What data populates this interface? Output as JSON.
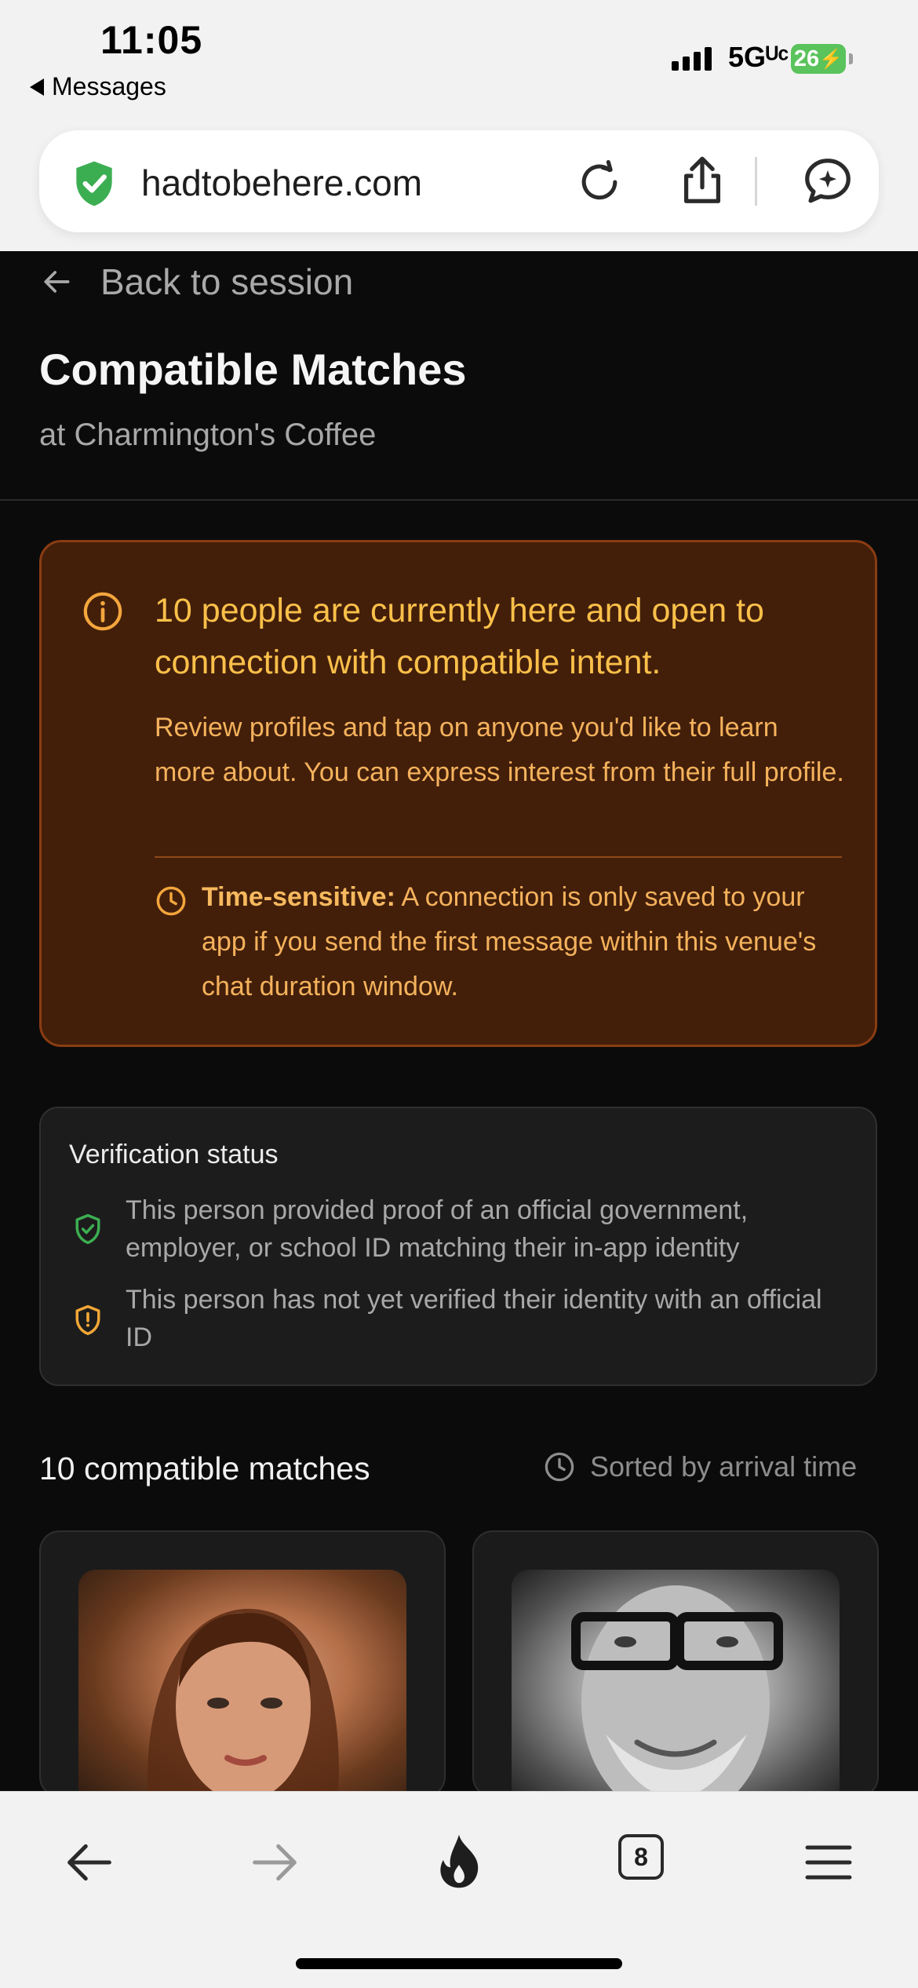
{
  "status_bar": {
    "time": "11:05",
    "back_app_label": "Messages",
    "network": "5Gᵁᶜ",
    "battery": "26"
  },
  "url_bar": {
    "url": "hadtobehere.com",
    "shield_color": "#3cae52"
  },
  "nav": {
    "back_label": "Back to session"
  },
  "header": {
    "title": "Compatible Matches",
    "venue": "at Charmington's Coffee"
  },
  "notice": {
    "headline": "10 people are currently here and open to connection with compatible intent.",
    "body": "Review profiles and tap on anyone you'd like to learn more about. You can express interest from their full profile.",
    "time_label": "Time-sensitive:",
    "time_text": " A connection is only saved to your app if you send the first message within this venue's chat duration window.",
    "accent_color": "#f4a63c"
  },
  "verification": {
    "title": "Verification status",
    "verified_text": "This person provided proof of an official government, employer, or school ID matching their in-app identity",
    "unverified_text": "This person has not yet verified their identity with an official ID",
    "verified_color": "#3cae52",
    "unverified_color": "#f2a736"
  },
  "matches": {
    "count_label": "10 compatible matches",
    "sort_label": "Sorted by arrival time"
  },
  "toolbar": {
    "tabs_count": "8"
  }
}
